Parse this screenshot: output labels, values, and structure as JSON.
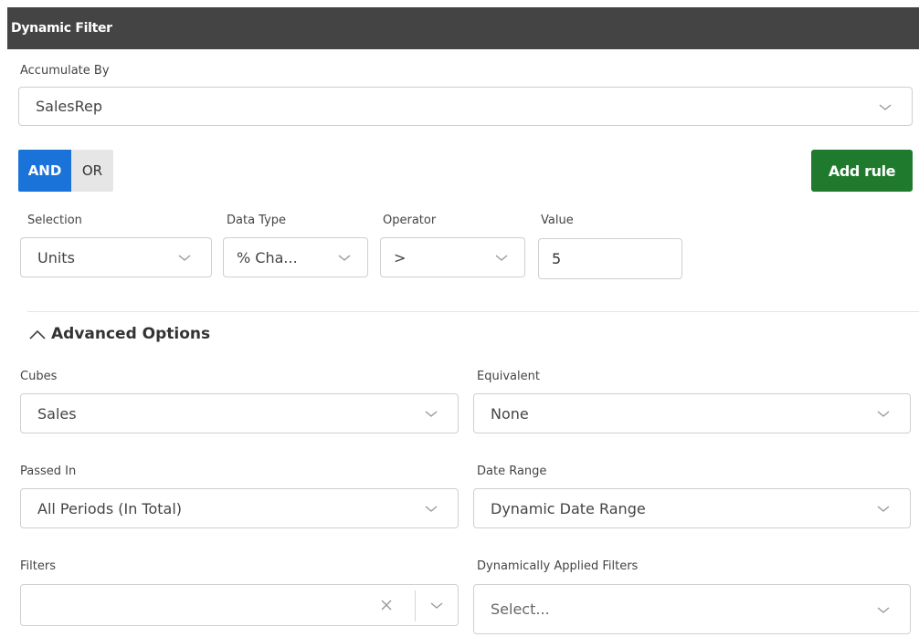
{
  "header": {
    "title": "Dynamic Filter"
  },
  "accumulate": {
    "label": "Accumulate By",
    "value": "SalesRep"
  },
  "logic": {
    "and_label": "AND",
    "or_label": "OR",
    "selected": "AND"
  },
  "add_rule_label": "Add rule",
  "rule": {
    "selection": {
      "label": "Selection",
      "value": "Units"
    },
    "data_type": {
      "label": "Data Type",
      "value": "% Cha..."
    },
    "operator": {
      "label": "Operator",
      "value": ">"
    },
    "value": {
      "label": "Value",
      "value": "5"
    }
  },
  "advanced": {
    "label": "Advanced Options",
    "cubes": {
      "label": "Cubes",
      "value": "Sales"
    },
    "equivalent": {
      "label": "Equivalent",
      "value": "None"
    },
    "passed_in": {
      "label": "Passed In",
      "value": "All Periods (In Total)"
    },
    "date_range": {
      "label": "Date Range",
      "value": "Dynamic Date Range"
    },
    "filters": {
      "label": "Filters",
      "value": ""
    },
    "dynamic_filters": {
      "label": "Dynamically Applied Filters",
      "placeholder": "Select..."
    }
  },
  "colors": {
    "header_bg": "#444444",
    "and_active": "#1a73d9",
    "add_rule_bg": "#1f7a2e"
  }
}
